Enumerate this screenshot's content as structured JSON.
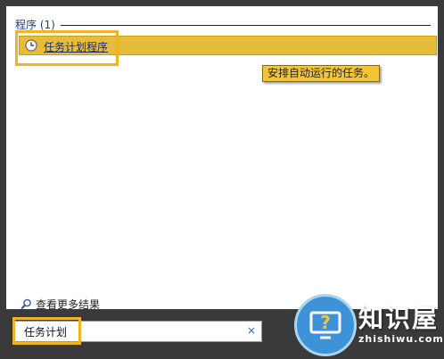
{
  "group": {
    "title": "程序 (1)"
  },
  "result": {
    "label": "任务计划程序",
    "icon": "clock-icon"
  },
  "tooltip": {
    "text": "安排自动运行的任务。"
  },
  "see_more": {
    "label": "查看更多结果",
    "icon": "magnifier-icon"
  },
  "search": {
    "value": "任务计划",
    "clear_glyph": "×"
  },
  "watermark": {
    "brand": "知识屋",
    "url": "zhishiwu.com"
  },
  "colors": {
    "highlight": "#e5bd3a",
    "annotation_box": "#f0b323",
    "link": "#1a2a6c"
  }
}
